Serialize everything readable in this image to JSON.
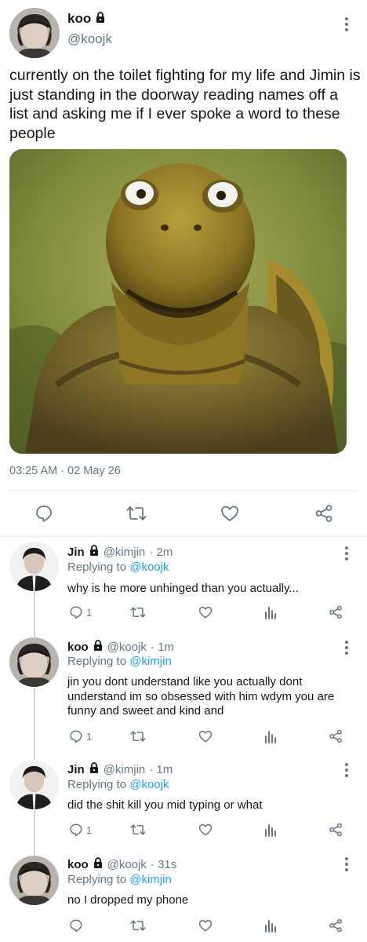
{
  "main_tweet": {
    "name": "koo",
    "handle": "@koojk",
    "text": "currently on the toilet fighting for my life and Jimin is just standing in the doorway reading names off a list and asking me if I ever spoke a word to these people",
    "media_icon": "turtle-cartoon-image",
    "timestamp": "03:25 AM · 02 May 26",
    "actions": [
      "reply-icon",
      "retweet-icon",
      "like-icon",
      "share-icon"
    ]
  },
  "replies": [
    {
      "name": "Jin",
      "handle": "@kimjin",
      "time": "· 2m",
      "replying_prefix": "Replying to",
      "replying_to": "@koojk",
      "text": "why is he more unhinged than you actually...",
      "reply_count": "1"
    },
    {
      "name": "koo",
      "handle": "@koojk",
      "time": "· 1m",
      "replying_prefix": "Replying to",
      "replying_to": "@kimjin",
      "text": "jin you dont understand like you actually dont understand im so obsessed with him wdym you are funny and sweet and kind and",
      "reply_count": "1"
    },
    {
      "name": "Jin",
      "handle": "@kimjin",
      "time": "· 1m",
      "replying_prefix": "Replying to",
      "replying_to": "@koojk",
      "text": "did the shit kill you mid typing or what",
      "reply_count": "1"
    },
    {
      "name": "koo",
      "handle": "@koojk",
      "time": "· 31s",
      "replying_prefix": "Replying to",
      "replying_to": "@kimjin",
      "text": "no I dropped my phone",
      "reply_count": ""
    }
  ],
  "colors": {
    "text": "#14171a",
    "secondary": "#657786",
    "link": "#1da1f2",
    "divider": "#e1e8ed"
  }
}
